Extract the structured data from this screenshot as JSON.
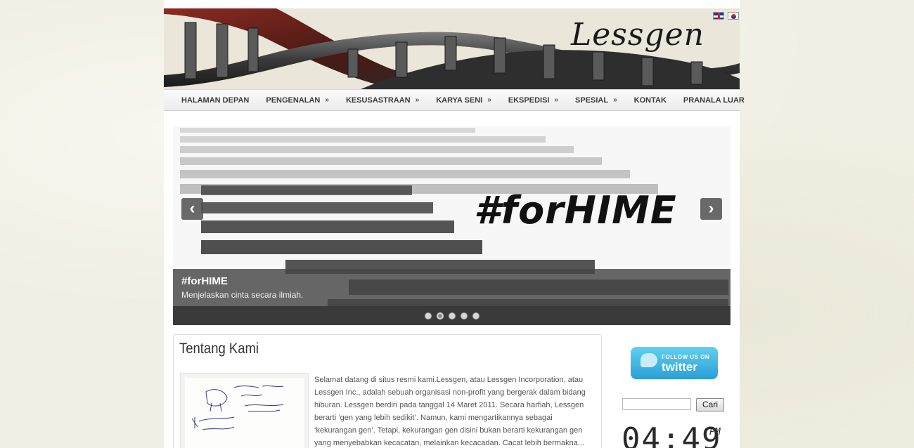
{
  "header": {
    "logo_text": "Lessgen",
    "languages": [
      "english-flag-icon",
      "korean-flag-icon"
    ]
  },
  "nav": {
    "items": [
      {
        "label": "HALAMAN DEPAN",
        "has_submenu": false
      },
      {
        "label": "PENGENALAN",
        "has_submenu": true
      },
      {
        "label": "KESUSASTRAAN",
        "has_submenu": true
      },
      {
        "label": "KARYA SENI",
        "has_submenu": true
      },
      {
        "label": "EKSPEDISI",
        "has_submenu": true
      },
      {
        "label": "SPESIAL",
        "has_submenu": true
      },
      {
        "label": "KONTAK",
        "has_submenu": false
      },
      {
        "label": "PRANALA LUAR",
        "has_submenu": false
      }
    ],
    "submenu_glyph": "»"
  },
  "slider": {
    "image_hashtag": "#forHIME",
    "caption_title": "#forHIME",
    "caption_text": "Menjelaskan cinta secara ilmiah.",
    "prev_glyph": "‹",
    "next_glyph": "›",
    "dots": 5,
    "active_dot": 2
  },
  "content": {
    "title": "Tentang Kami",
    "text": "Selamat datang di situs resmi kami.Lessgen, atau Lessgen Incorporation, atau Lessgen Inc., adalah sebuah organisasi non-profit yang bergerak dalam bidang  hiburan. Lessgen berdiri pada tanggal 14 Maret 2011. Secara harfiah, Lessgen berarti ‘gen yang lebih sedikit’. Namun, kami mengartikannya sebagai ‘kekurangan gen’. Tetapi, kekurangan gen disini bukan berarti kekurangan gen yang menyebabkan kecacatan, melainkan kecacadan. Cacat lebih bermakna..."
  },
  "sidebar": {
    "twitter_follow": "FOLLOW US ON",
    "twitter_brand": "twitter",
    "search_placeholder": "",
    "search_button": "Cari",
    "clock_time": "04:49",
    "clock_ampm": "PM"
  },
  "colors": {
    "background": "#f1efe3",
    "nav_text": "#3a3a3a",
    "caption_bg": "#464646",
    "twitter_blue": "#2a9fd8"
  }
}
